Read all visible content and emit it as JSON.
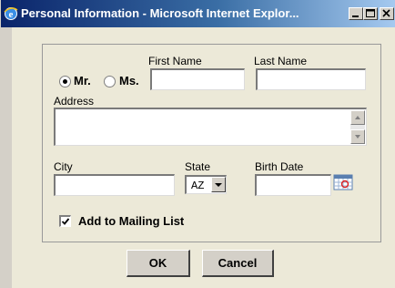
{
  "window": {
    "title": "Personal Information - Microsoft Internet Explor..."
  },
  "form": {
    "salutation_options": [
      "Mr.",
      "Ms."
    ],
    "salutation_selected": "Mr.",
    "first_name_label": "First Name",
    "first_name_value": "",
    "last_name_label": "Last Name",
    "last_name_value": "",
    "address_label": "Address",
    "address_value": "",
    "city_label": "City",
    "city_value": "",
    "state_label": "State",
    "state_value": "AZ",
    "birth_date_label": "Birth Date",
    "birth_date_value": "",
    "mailing_list_label": "Add to Mailing List",
    "mailing_list_checked": true
  },
  "buttons": {
    "ok_label": "OK",
    "cancel_label": "Cancel"
  },
  "icons": {
    "title_icon": "ie-icon",
    "calendar_icon": "calendar-icon"
  }
}
